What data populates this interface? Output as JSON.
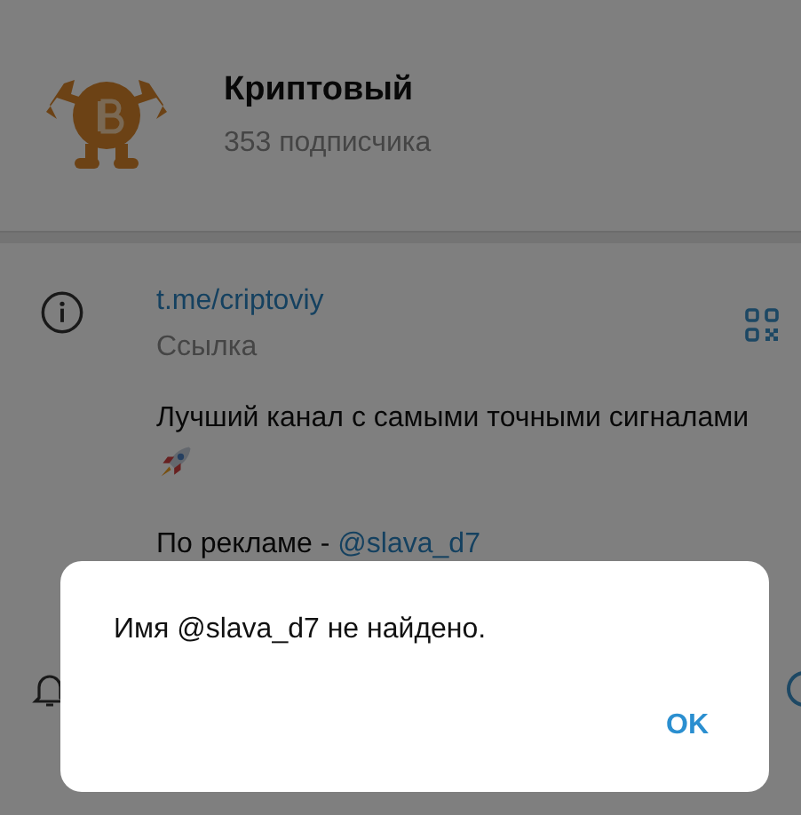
{
  "channel": {
    "title": "Криптовый",
    "subscribers": "353 подписчика"
  },
  "info": {
    "link": "t.me/criptoviy",
    "link_label": "Ссылка",
    "description": "Лучший канал с самыми точными сигналами",
    "ads_text": "По рекламе - ",
    "ads_handle": "@slava_d7"
  },
  "notifications": {
    "on": true
  },
  "dialog": {
    "message": "Имя @slava_d7 не найдено.",
    "button": "OK"
  }
}
